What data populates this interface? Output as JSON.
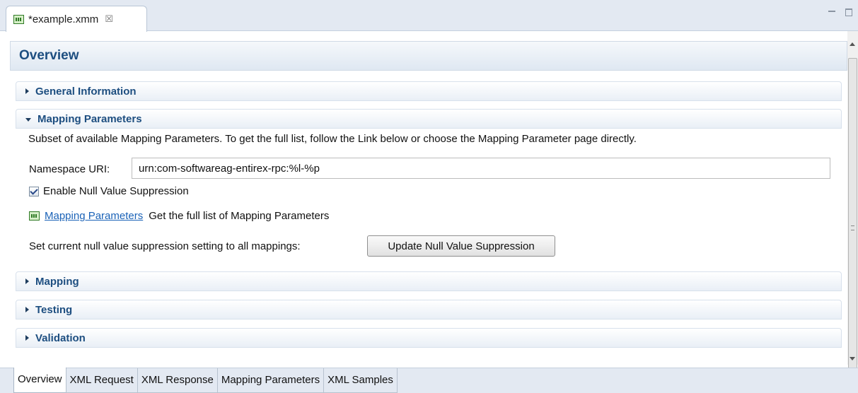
{
  "editor": {
    "tab_title": "*example.xmm",
    "close_glyph": "☒",
    "file_icon": "xmm-file-icon"
  },
  "header": {
    "title": "Overview"
  },
  "sections": {
    "general": {
      "title": "General Information",
      "expanded": false
    },
    "mapping_parameters": {
      "title": "Mapping Parameters",
      "expanded": true,
      "description": "Subset of available Mapping Parameters. To get the full list, follow the Link below or choose the Mapping Parameter page directly.",
      "namespace_label": "Namespace URI:",
      "namespace_value": "urn:com-softwareag-entirex-rpc:%l-%p",
      "null_suppression_label": "Enable Null Value Suppression",
      "null_suppression_checked": true,
      "link_text": "Mapping Parameters",
      "link_description": "Get the full list of Mapping Parameters",
      "update_label": "Set current null value suppression setting to all mappings:",
      "update_button": "Update Null Value Suppression"
    },
    "mapping": {
      "title": "Mapping",
      "expanded": false
    },
    "testing": {
      "title": "Testing",
      "expanded": false
    },
    "validation": {
      "title": "Validation",
      "expanded": false
    }
  },
  "page_tabs": [
    {
      "label": "Overview",
      "active": true
    },
    {
      "label": "XML Request",
      "active": false
    },
    {
      "label": "XML Response",
      "active": false
    },
    {
      "label": "Mapping Parameters",
      "active": false
    },
    {
      "label": "XML Samples",
      "active": false
    }
  ],
  "colors": {
    "section_title": "#1d4e80",
    "link": "#1a62b7",
    "tab_bar": "#e3e9f2"
  }
}
